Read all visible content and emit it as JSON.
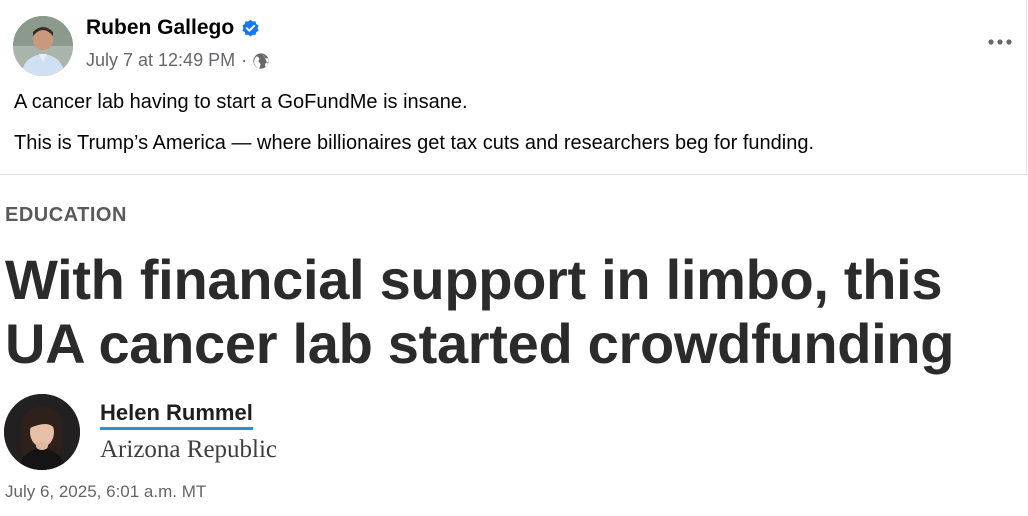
{
  "post": {
    "author_name": "Ruben Gallego",
    "timestamp": "July 7 at 12:49 PM",
    "separator": "·",
    "text_line_1": "A cancer lab having to start a GoFundMe is insane.",
    "text_line_2": "This is Trump’s America — where billionaires get tax cuts and researchers beg for funding.",
    "icons": {
      "verified": "verified-badge-icon",
      "audience": "globe-icon",
      "more": "more-options-icon"
    },
    "colors": {
      "verified_badge": "#1877f2",
      "meta_text": "#65676b"
    }
  },
  "article": {
    "section": "EDUCATION",
    "headline": "With financial support in limbo, this UA cancer lab started crowdfunding",
    "author": "Helen Rummel",
    "publication": "Arizona Republic",
    "date": "July 6, 2025, 6:01 a.m. MT",
    "colors": {
      "author_underline": "#2a8fd8",
      "headline": "#2b2b2b"
    }
  }
}
